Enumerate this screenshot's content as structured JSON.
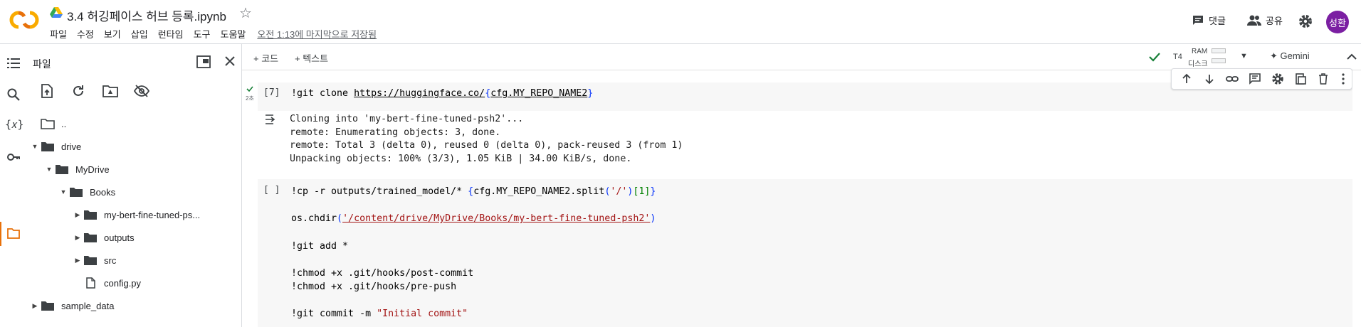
{
  "header": {
    "title": "3.4 허깅페이스 허브 등록.ipynb",
    "menu": [
      "파일",
      "수정",
      "보기",
      "삽입",
      "런타임",
      "도구",
      "도움말"
    ],
    "saved_status": "오전 1:13에 마지막으로 저장됨",
    "comments_label": "댓글",
    "share_label": "공유",
    "avatar_text": "성환"
  },
  "sidebar": {
    "title": "파일",
    "tree": [
      {
        "label": "..",
        "type": "folder",
        "depth": 0,
        "toggle": "none"
      },
      {
        "label": "drive",
        "type": "folder",
        "depth": 0,
        "toggle": "open"
      },
      {
        "label": "MyDrive",
        "type": "folder",
        "depth": 1,
        "toggle": "open"
      },
      {
        "label": "Books",
        "type": "folder",
        "depth": 2,
        "toggle": "open"
      },
      {
        "label": "my-bert-fine-tuned-ps...",
        "type": "folder",
        "depth": 3,
        "toggle": "closed"
      },
      {
        "label": "outputs",
        "type": "folder",
        "depth": 3,
        "toggle": "closed"
      },
      {
        "label": "src",
        "type": "folder",
        "depth": 3,
        "toggle": "closed"
      },
      {
        "label": "config.py",
        "type": "file",
        "depth": 3,
        "toggle": "none"
      },
      {
        "label": "sample_data",
        "type": "folder",
        "depth": 0,
        "toggle": "closed"
      }
    ]
  },
  "toolbar": {
    "add_code": "+ 코드",
    "add_text": "+ 텍스트",
    "runtime": "T4",
    "ram_label": "RAM",
    "disk_label": "디스크",
    "gemini_label": "Gemini"
  },
  "cells": {
    "cell1": {
      "exec_count": "[7]",
      "duration": "2초",
      "code_prefix": "!git clone ",
      "code_url": "https://huggingface.co/",
      "code_brace_open": "{",
      "code_var": "cfg.MY_REPO_NAME2",
      "code_brace_close": "}",
      "output": "Cloning into 'my-bert-fine-tuned-psh2'...\nremote: Enumerating objects: 3, done.\nremote: Total 3 (delta 0), reused 0 (delta 0), pack-reused 3 (from 1)\nUnpacking objects: 100% (3/3), 1.05 KiB | 34.00 KiB/s, done."
    },
    "cell2": {
      "exec_count": "[ ]",
      "line1_a": "!cp -r outputs/trained_model/* ",
      "line1_b": "{",
      "line1_c": "cfg.MY_REPO_NAME2.split",
      "line1_d": "(",
      "line1_e": "'/'",
      "line1_f": ")",
      "line1_g": "[1]",
      "line1_h": "}",
      "line2_a": "os.chdir",
      "line2_b": "(",
      "line2_c": "'/content/drive/MyDrive/Books/my-bert-fine-tuned-psh2'",
      "line2_d": ")",
      "line3": "!git add *",
      "line4": "!chmod +x .git/hooks/post-commit",
      "line5": "!chmod +x .git/hooks/pre-push",
      "line6_a": "!git commit -m ",
      "line6_b": "\"Initial commit\""
    }
  }
}
